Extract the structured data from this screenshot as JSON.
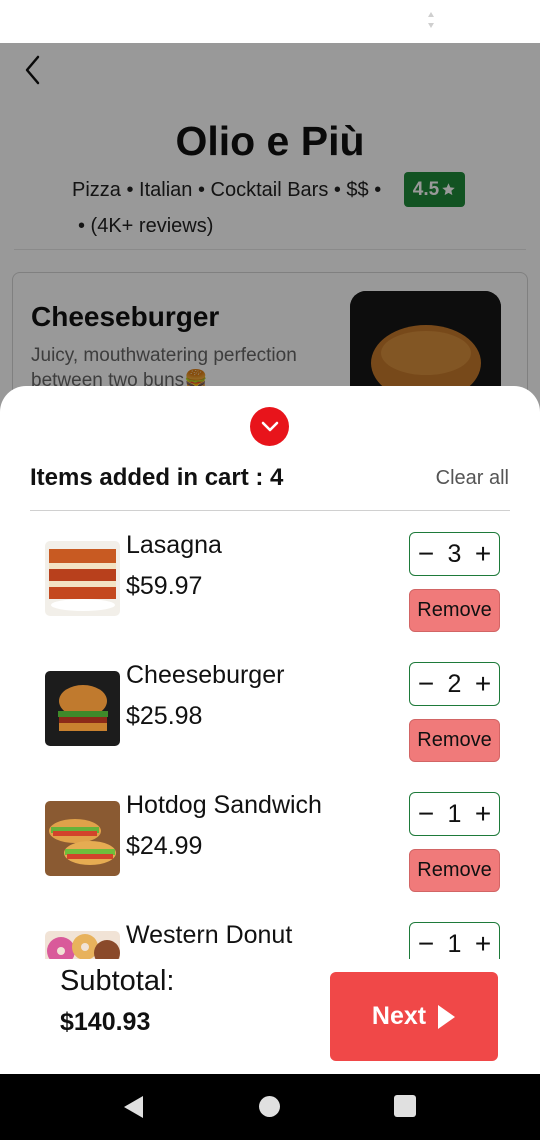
{
  "restaurant": {
    "name": "Olio e Più",
    "meta": "Pizza • Italian • Cocktail Bars • $$  •",
    "rating": "4.5",
    "reviews": "• (4K+ reviews)"
  },
  "menu_item": {
    "title": "Cheeseburger",
    "description": "Juicy, mouthwatering perfection between two buns🍔"
  },
  "cart": {
    "title": "Items added in cart : 4",
    "clear_all": "Clear all",
    "remove_label": "Remove",
    "items": [
      {
        "name": "Lasagna",
        "price": "$59.97",
        "qty": "3"
      },
      {
        "name": "Cheeseburger",
        "price": "$25.98",
        "qty": "2"
      },
      {
        "name": "Hotdog Sandwich",
        "price": "$24.99",
        "qty": "1"
      },
      {
        "name": "Western Donut",
        "price": "",
        "qty": "1"
      }
    ],
    "subtotal_label": "Subtotal:",
    "subtotal_value": "$140.93",
    "next_label": "Next"
  },
  "colors": {
    "accent_red": "#f04848",
    "remove_red": "#f07a7a",
    "rating_green": "#1e8a3a",
    "stepper_border": "#1e7a3a"
  },
  "icons": {
    "back": "chevron-left-icon",
    "collapse": "chevron-down-icon",
    "rating": "star-icon",
    "next": "play-triangle-icon"
  }
}
